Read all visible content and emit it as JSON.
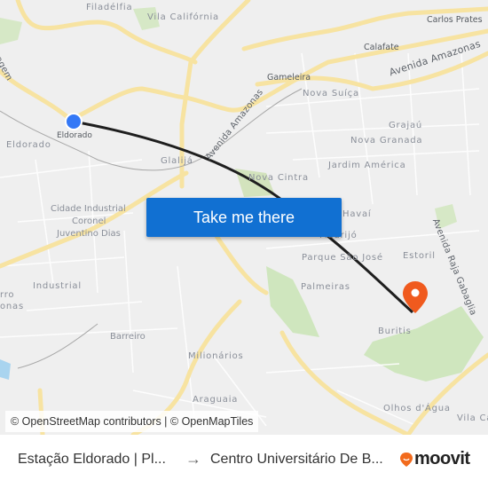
{
  "map": {
    "neighborhood_labels": [
      {
        "text": "Filadélfia",
        "id": "filadelfia"
      },
      {
        "text": "Vila Califórnia",
        "id": "vila-california"
      },
      {
        "text": "Eldorado",
        "id": "eldorado"
      },
      {
        "text": "Glalijá",
        "id": "glalija"
      },
      {
        "text": "Cidade Industrial",
        "id": "cidade-industrial-1"
      },
      {
        "text": "Coronel",
        "id": "cidade-industrial-2"
      },
      {
        "text": "Juventino Dias",
        "id": "cidade-industrial-3"
      },
      {
        "text": "Industrial",
        "id": "industrial"
      },
      {
        "text": "rro",
        "id": "barreiro-cut-1"
      },
      {
        "text": "onas",
        "id": "barreiro-cut-2"
      },
      {
        "text": "Barreiro",
        "id": "barreiro"
      },
      {
        "text": "Milionários",
        "id": "milionarios"
      },
      {
        "text": "Araguaia",
        "id": "araguaia"
      },
      {
        "text": "Nova Suíça",
        "id": "nova-suica"
      },
      {
        "text": "Grajaú",
        "id": "grajau"
      },
      {
        "text": "Nova Granada",
        "id": "nova-granada"
      },
      {
        "text": "Jardim América",
        "id": "jardim-america"
      },
      {
        "text": "Nova Cintra",
        "id": "nova-cintra"
      },
      {
        "text": "Havaí",
        "id": "havai"
      },
      {
        "text": "Madrijó",
        "id": "madrijo"
      },
      {
        "text": "Parque São José",
        "id": "parque-sao-jose"
      },
      {
        "text": "Estoril",
        "id": "estoril"
      },
      {
        "text": "Palmeiras",
        "id": "palmeiras"
      },
      {
        "text": "Buritis",
        "id": "buritis"
      },
      {
        "text": "Olhos d'Água",
        "id": "olhos-dagua"
      },
      {
        "text": "Vila Ca",
        "id": "vila-ca"
      }
    ],
    "place_labels": [
      {
        "text": "Carlos Prates",
        "id": "carlos-prates"
      },
      {
        "text": "Calafate",
        "id": "calafate"
      },
      {
        "text": "Gameleira",
        "id": "gameleira"
      }
    ],
    "road_labels": [
      {
        "text": "Avenida Amazonas",
        "id": "av-amazonas-east"
      },
      {
        "text": "Avenida Amazonas",
        "id": "av-amazonas-west"
      },
      {
        "text": "Avenida Raja Gabaglia",
        "id": "av-raja-gabaglia"
      },
      {
        "text": "agem",
        "id": "via-cut"
      }
    ],
    "origin": {
      "label": "Eldorado",
      "color": "#3478f6"
    },
    "destination": {
      "color": "#f05a1e"
    },
    "route_color": "#1e1e1e"
  },
  "cta": {
    "label": "Take me there",
    "color": "#1170d2"
  },
  "attribution": {
    "text": "© OpenStreetMap contributors | © OpenMapTiles"
  },
  "footer": {
    "from": "Estação Eldorado | Pl...",
    "arrow": "→",
    "to": "Centro Universitário De B...",
    "brand": "moovit",
    "brand_color": "#f26b1d"
  }
}
